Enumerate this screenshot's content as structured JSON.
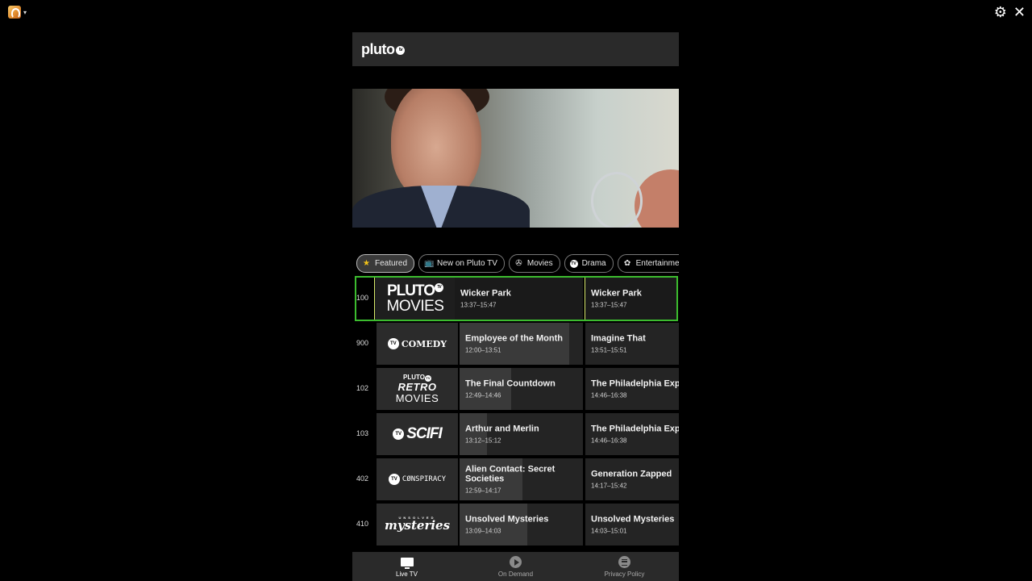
{
  "app": {
    "brand": "pluto",
    "brand_badge": "tv"
  },
  "window": {
    "caret": "▾",
    "settings_glyph": "⚙",
    "close_glyph": "✕"
  },
  "categories": [
    {
      "label": "Featured",
      "icon": "star-icon",
      "glyph": "★",
      "active": true
    },
    {
      "label": "New on Pluto TV",
      "icon": "tv-icon",
      "glyph": "📺",
      "active": false
    },
    {
      "label": "Movies",
      "icon": "film-reel-icon",
      "glyph": "✇",
      "active": false
    },
    {
      "label": "Drama",
      "icon": "tv-badge-icon",
      "glyph": "TV",
      "active": false
    },
    {
      "label": "Entertainment",
      "icon": "popcorn-icon",
      "glyph": "✿",
      "active": false
    }
  ],
  "guide": [
    {
      "number": "100",
      "channel": "Pluto TV Movies",
      "logo_lines": [
        "PLUTO",
        "MOVIES"
      ],
      "logo_badge": "TV",
      "now": {
        "title": "Wicker Park",
        "time": "13:37–15:47",
        "progress": 0
      },
      "next": {
        "title": "Wicker Park",
        "time": "13:37–15:47"
      },
      "selected": true
    },
    {
      "number": "900",
      "channel": "Pluto TV Comedy",
      "logo_lines": [
        "COMEDY"
      ],
      "logo_badge": "TV",
      "now": {
        "title": "Employee of the Month",
        "time": "12:00–13:51",
        "progress": 0.89
      },
      "next": {
        "title": "Imagine That",
        "time": "13:51–15:51"
      },
      "selected": false
    },
    {
      "number": "102",
      "channel": "Pluto TV Retro Movies",
      "logo_lines": [
        "PLUTO",
        "RETRO",
        "MOVIES"
      ],
      "logo_badge": "TV",
      "now": {
        "title": "The Final Countdown",
        "time": "12:49–14:46",
        "progress": 0.42
      },
      "next": {
        "title": "The Philadelphia Expe",
        "time": "14:46–16:38"
      },
      "selected": false
    },
    {
      "number": "103",
      "channel": "Pluto TV Sci-Fi",
      "logo_lines": [
        "SCIFI"
      ],
      "logo_badge": "TV",
      "now": {
        "title": "Arthur and Merlin",
        "time": "13:12–15:12",
        "progress": 0.22
      },
      "next": {
        "title": "The Philadelphia Expe",
        "time": "14:46–16:38"
      },
      "selected": false
    },
    {
      "number": "402",
      "channel": "Pluto TV Conspiracy",
      "logo_lines": [
        "CØNSPIRACY"
      ],
      "logo_badge": "TV",
      "now": {
        "title": "Alien Contact: Secret Societies",
        "time": "12:59–14:17",
        "progress": 0.51
      },
      "next": {
        "title": "Generation Zapped",
        "time": "14:17–15:42"
      },
      "selected": false
    },
    {
      "number": "410",
      "channel": "Unsolved Mysteries",
      "logo_lines": [
        "mysteries"
      ],
      "logo_small": "UNSOLVED",
      "now": {
        "title": "Unsolved Mysteries",
        "time": "13:09–14:03",
        "progress": 0.55
      },
      "next": {
        "title": "Unsolved Mysteries",
        "time": "14:03–15:01"
      },
      "selected": false
    }
  ],
  "bottom_nav": [
    {
      "label": "Live TV",
      "icon": "tv-icon",
      "active": true
    },
    {
      "label": "On Demand",
      "icon": "play-circle-icon",
      "active": false
    },
    {
      "label": "Privacy Policy",
      "icon": "document-circle-icon",
      "active": false
    }
  ],
  "colors": {
    "selected_border": "#3cbc2f",
    "accent_line": "#d7e96a",
    "header_bg": "#2a2a2a"
  }
}
